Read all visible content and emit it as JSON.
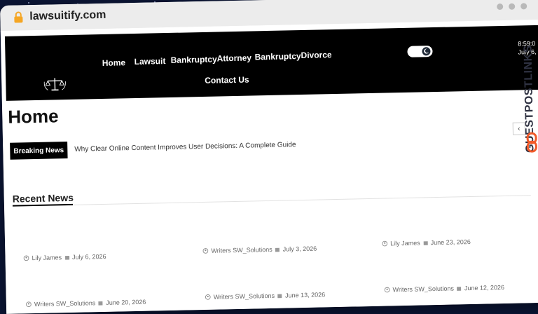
{
  "browser": {
    "url": "lawsuitify.com"
  },
  "nav": [
    "Home",
    "Lawsuit",
    "Bankruptcy",
    "Attorney",
    "Bankruptcy",
    "Divorce",
    "Contact Us"
  ],
  "header": {
    "time": "8:59:0",
    "date": "July 6, 2"
  },
  "watermark": {
    "text": "GUESTPOSTLINKS"
  },
  "page": {
    "title": "Home",
    "breaking_label": "Breaking News",
    "breaking_headline": "Why Clear Online Content Improves User Decisions: A Complete Guide",
    "recent_title": "Recent News"
  },
  "posts": [
    {
      "author": "Lily James",
      "date": "July 6, 2026"
    },
    {
      "author": "Writers SW_Solutions",
      "date": "July 3, 2026"
    },
    {
      "author": "Lily James",
      "date": "June 23, 2026"
    },
    {
      "author": "Writers SW_Solutions",
      "date": "June 20, 2026"
    },
    {
      "author": "Writers SW_Solutions",
      "date": "June 13, 2026"
    },
    {
      "author": "Writers SW_Solutions",
      "date": "June 12, 2026"
    }
  ]
}
